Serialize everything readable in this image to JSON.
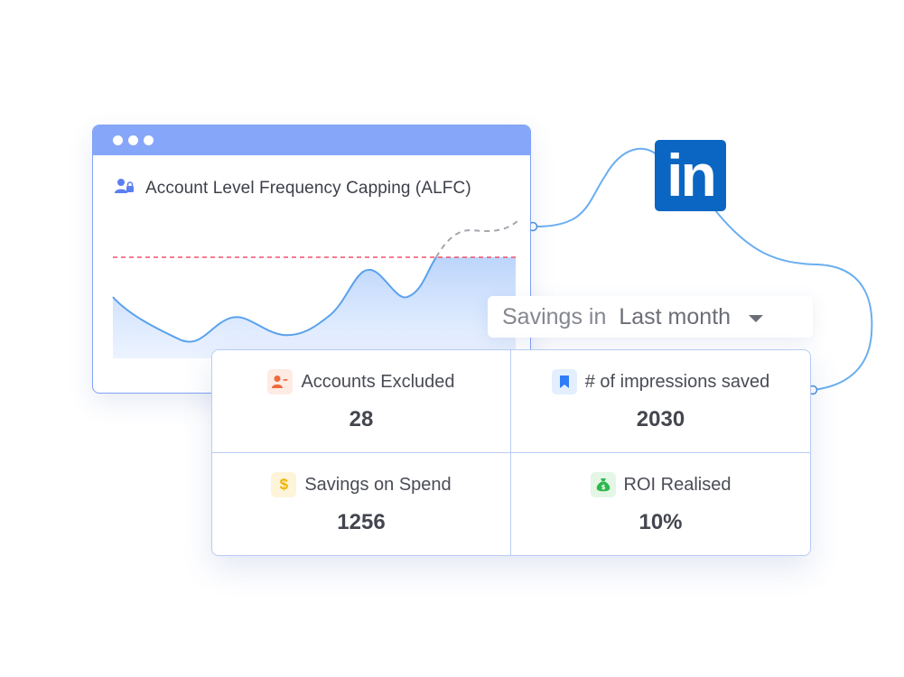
{
  "colors": {
    "accent_blue": "#86a6fa",
    "line_blue": "#69a8f0",
    "threshold_red": "#f0506e",
    "linkedin_blue": "#0a66c2",
    "orange": "#f06a3a",
    "bookmark_blue": "#2f7df5",
    "gold": "#f0b400",
    "green": "#2db84b"
  },
  "window": {
    "title": "Account Level Frequency Capping (ALFC)",
    "title_icon": "user-lock-icon"
  },
  "linkedin": {
    "logo_text": "in"
  },
  "savings": {
    "label": "Savings in",
    "selected": "Last month",
    "caret_icon": "caret-down-icon"
  },
  "stats": [
    {
      "label": "Accounts Excluded",
      "value": "28",
      "icon": "user-minus-icon"
    },
    {
      "label": "# of impressions saved",
      "value": "2030",
      "icon": "bookmark-icon"
    },
    {
      "label": "Savings on Spend",
      "value": "1256",
      "icon": "dollar-icon"
    },
    {
      "label": "ROI Realised",
      "value": "10%",
      "icon": "money-bag-icon"
    }
  ]
}
